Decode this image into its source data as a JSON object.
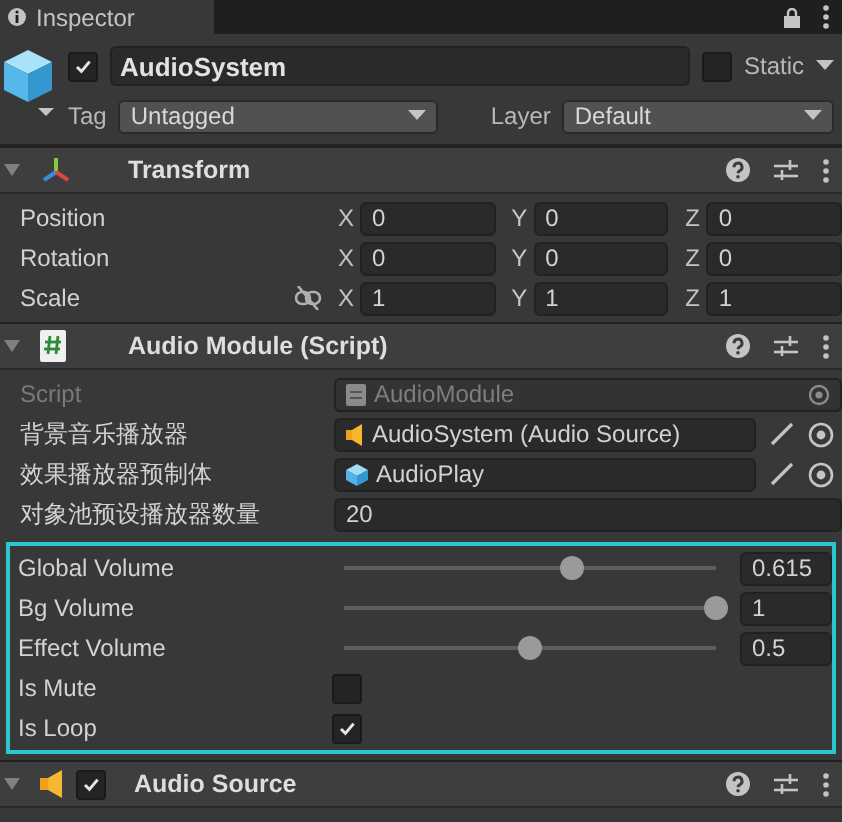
{
  "window": {
    "title": "Inspector"
  },
  "object": {
    "active": true,
    "name": "AudioSystem",
    "static": false,
    "static_label": "Static",
    "tag_label": "Tag",
    "tag": "Untagged",
    "layer_label": "Layer",
    "layer": "Default"
  },
  "components": [
    {
      "kind": "transform",
      "title": "Transform",
      "expanded": true,
      "rows": [
        {
          "kind": "vector",
          "label": "Position",
          "axes": [
            "X",
            "Y",
            "Z"
          ],
          "values": [
            "0",
            "0",
            "0"
          ]
        },
        {
          "kind": "vector",
          "label": "Rotation",
          "axes": [
            "X",
            "Y",
            "Z"
          ],
          "values": [
            "0",
            "0",
            "0"
          ]
        },
        {
          "kind": "vector",
          "label": "Scale",
          "constrained": false,
          "axes": [
            "X",
            "Y",
            "Z"
          ],
          "values": [
            "1",
            "1",
            "1"
          ]
        }
      ]
    },
    {
      "kind": "script",
      "title": "Audio Module (Script)",
      "expanded": true,
      "rows": [
        {
          "kind": "script",
          "label": "Script",
          "value": "AudioModule",
          "disabled": true
        },
        {
          "kind": "audio-ref",
          "label": "背景音乐播放器",
          "value": "AudioSystem (Audio Source)"
        },
        {
          "kind": "prefab-ref",
          "label": "效果播放器预制体",
          "value": "AudioPlay"
        },
        {
          "kind": "text",
          "label": "对象池预设播放器数量",
          "value": "20"
        }
      ],
      "highlighted_rows": [
        {
          "kind": "slider",
          "label": "Global Volume",
          "level": 0.615,
          "reading": "0.615"
        },
        {
          "kind": "slider",
          "label": "Bg Volume",
          "level": 1,
          "reading": "1"
        },
        {
          "kind": "slider",
          "label": "Effect Volume",
          "level": 0.5,
          "reading": "0.5"
        },
        {
          "kind": "toggle",
          "label": "Is Mute",
          "checked": false
        },
        {
          "kind": "toggle",
          "label": "Is Loop",
          "checked": true
        }
      ]
    },
    {
      "kind": "audio",
      "title": "Audio Source",
      "enabled": true,
      "expanded": true
    }
  ]
}
